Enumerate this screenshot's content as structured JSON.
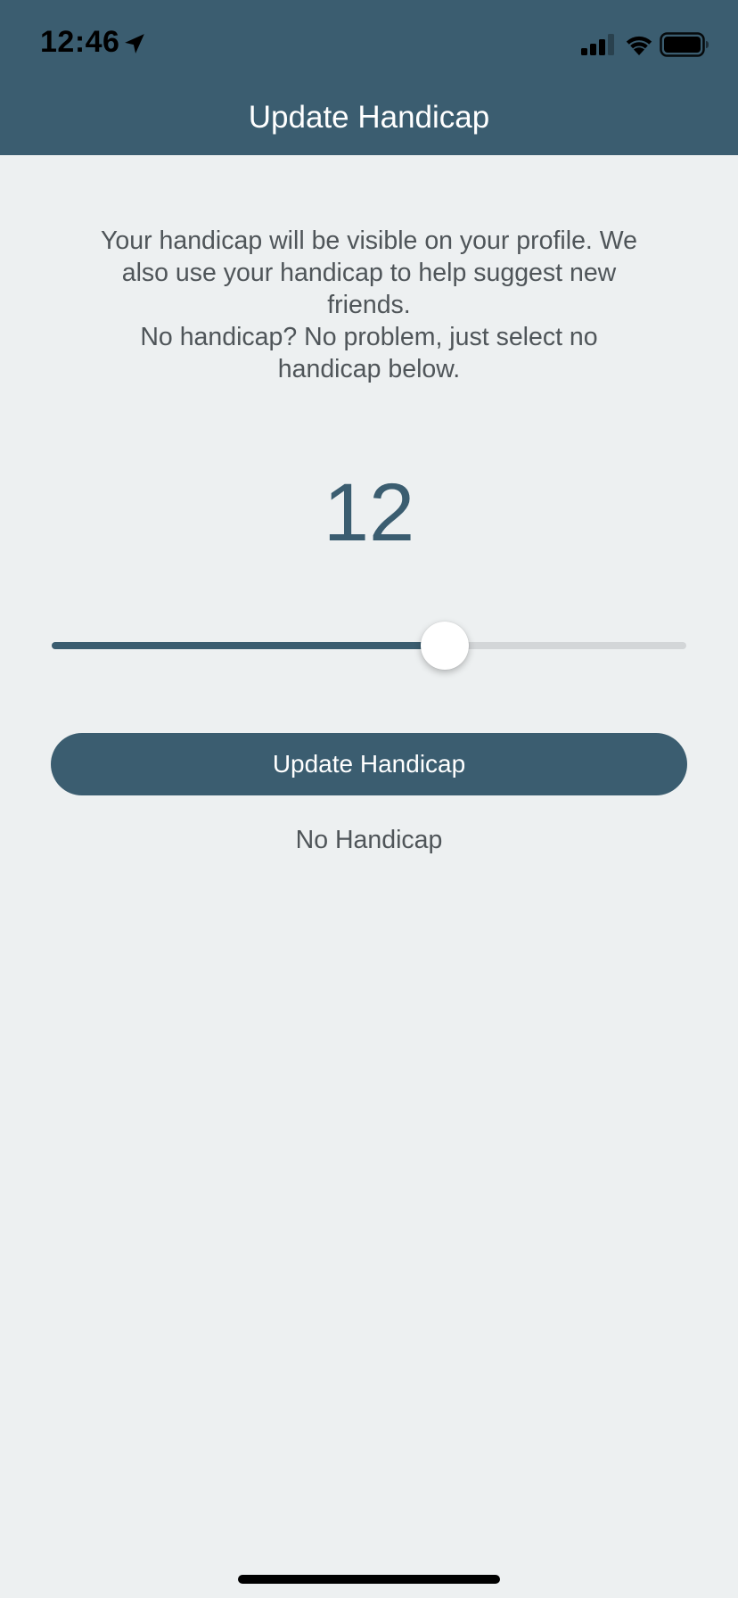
{
  "status_bar": {
    "time": "12:46"
  },
  "header": {
    "title": "Update Handicap"
  },
  "description": {
    "line1": "Your handicap will be visible on your profile. We also use your handicap to help suggest new friends.",
    "line2": "No handicap? No problem, just select no handicap below."
  },
  "handicap": {
    "value": "12",
    "slider_level": 0.62
  },
  "actions": {
    "update_label": "Update Handicap",
    "no_handicap_label": "No Handicap"
  },
  "colors": {
    "brand": "#3b5d70",
    "background": "#edf0f1",
    "text": "#4f5559",
    "track": "#d3d6d8"
  },
  "icons": [
    "location-arrow-icon",
    "cellular-signal-icon",
    "wifi-icon",
    "battery-icon"
  ]
}
